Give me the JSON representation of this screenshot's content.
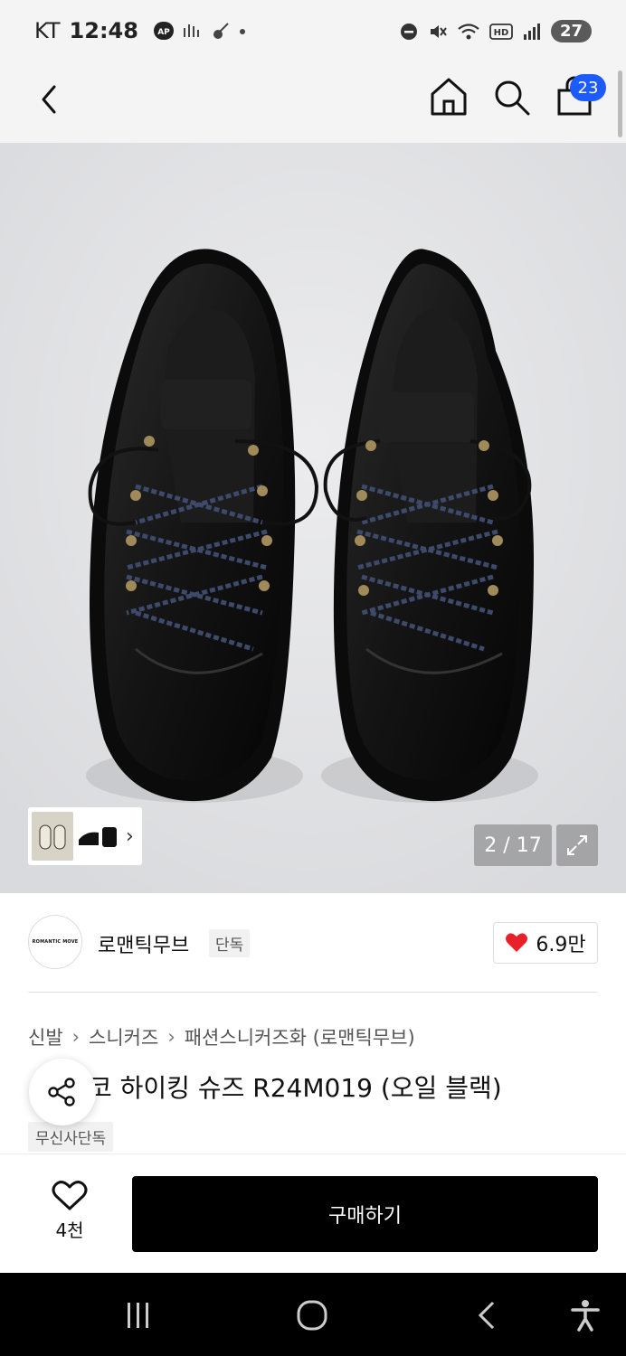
{
  "status_bar": {
    "carrier": "KT",
    "time": "12:48",
    "battery": "27"
  },
  "header": {
    "cart_count": "23"
  },
  "gallery": {
    "counter": "2 / 17"
  },
  "brand": {
    "logo_text": "ROMANTIC MOVE",
    "name": "로맨틱무브",
    "exclusive_tag": "단독",
    "likes": "6.9만"
  },
  "breadcrumb": {
    "items": [
      "신발",
      "스니커즈",
      "패션스니커즈화 (로맨틱무브)"
    ]
  },
  "product": {
    "title": "코 하이킹 슈즈 R24M019 (오일 블랙)",
    "badge": "무신사단독"
  },
  "bottom_bar": {
    "wish_count": "4천",
    "buy_label": "구매하기"
  },
  "colors": {
    "accent_blue": "#1e5bff",
    "heart_red": "#e8202a",
    "buy_button": "#000000"
  }
}
